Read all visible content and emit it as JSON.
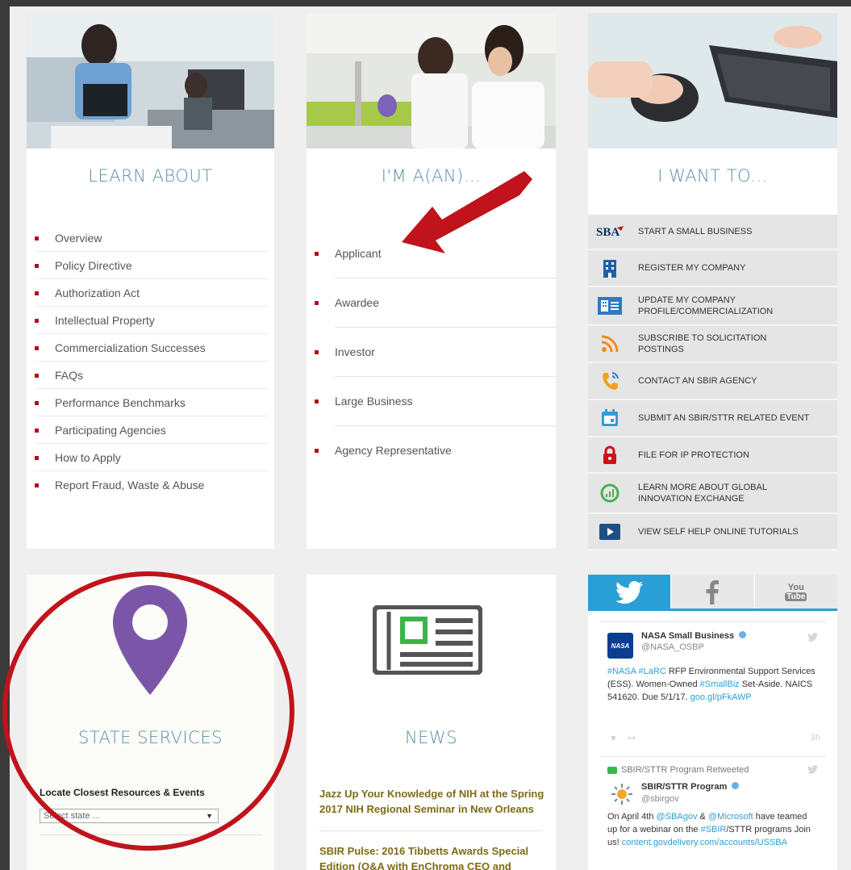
{
  "learn": {
    "title": "LEARN ABOUT",
    "items": [
      "Overview",
      "Policy Directive",
      "Authorization Act",
      "Intellectual Property",
      "Commercialization Successes",
      "FAQs",
      "Performance Benchmarks",
      "Participating Agencies",
      "How to Apply",
      "Report Fraud, Waste & Abuse"
    ]
  },
  "ima": {
    "title": "I'M A(AN)...",
    "items": [
      "Applicant",
      "Awardee",
      "Investor",
      "Large Business",
      "Agency Representative"
    ]
  },
  "want": {
    "title": "I WANT TO...",
    "sba_logo_text": "SBA",
    "items": [
      {
        "icon": "sba-logo-icon",
        "line1": "START A SMALL BUSINESS",
        "line2": ""
      },
      {
        "icon": "building-icon",
        "line1": "REGISTER MY COMPANY",
        "line2": ""
      },
      {
        "icon": "company-profile-icon",
        "line1": "UPDATE MY COMPANY",
        "line2": "PROFILE/COMMERCIALIZATION"
      },
      {
        "icon": "rss-icon",
        "line1": "SUBSCRIBE TO SOLICITATION",
        "line2": "POSTINGS"
      },
      {
        "icon": "phone-icon",
        "line1": "CONTACT AN SBIR AGENCY",
        "line2": ""
      },
      {
        "icon": "calendar-icon",
        "line1": "SUBMIT AN SBIR/STTR RELATED EVENT",
        "line2": ""
      },
      {
        "icon": "lock-icon",
        "line1": "FILE FOR IP PROTECTION",
        "line2": ""
      },
      {
        "icon": "globe-exchange-icon",
        "line1": "LEARN MORE ABOUT GLOBAL",
        "line2": "INNOVATION EXCHANGE"
      },
      {
        "icon": "video-play-icon",
        "line1": "VIEW SELF HELP ONLINE TUTORIALS",
        "line2": ""
      }
    ]
  },
  "state": {
    "title": "STATE SERVICES",
    "locate_label": "Locate Closest Resources & Events",
    "select_value": "Select state ..."
  },
  "news": {
    "title": "NEWS",
    "items": [
      "Jazz Up Your Knowledge of NIH at the Spring 2017 NIH Regional Seminar in New Orleans",
      "SBIR Pulse: 2016 Tibbetts Awards Special Edition (Q&A with EnChroma CEO and"
    ]
  },
  "social": {
    "youtube_label_top": "You",
    "youtube_label_bottom": "Tube",
    "tweet1": {
      "name": "NASA Small Business",
      "handle": "@NASA_OSBP",
      "avatar_text": "NASA",
      "text_parts": [
        "#NASA #LaRC",
        " RFP Environmental Support Services (ESS). Women-Owned ",
        "#SmallBiz",
        " Set-Aside. NAICS 541620. Due 5/1/17. ",
        "goo.gl/pFkAWP"
      ],
      "count": "3h"
    },
    "tweet2": {
      "retweet_label": "SBIR/STTR Program Retweeted",
      "name": "SBIR/STTR Program",
      "handle": "@sbirgov",
      "text_parts": [
        "On April 4th ",
        "@SBAgov",
        " & ",
        "@Microsoft",
        " have teamed up for a webinar on the ",
        "#SBIR",
        "/STTR programs Join us! ",
        "content.govdelivery.com/accounts/USSBA"
      ]
    }
  },
  "colors": {
    "accent_red": "#b0101a",
    "title_blue": "#5e8fa6",
    "twitter_blue": "#2a9fd6",
    "pin_purple": "#7b56a8",
    "news_green": "#3ab54a",
    "annotation_red": "#c0131b"
  }
}
